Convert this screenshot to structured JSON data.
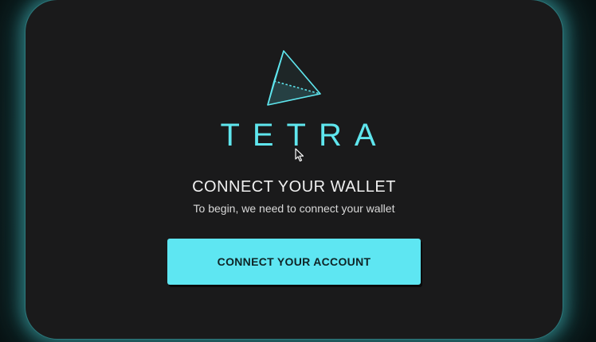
{
  "app": {
    "brand_name": "TETRA",
    "logo_icon": "tetrahedron-icon",
    "accent_color": "#5ee6f2"
  },
  "wallet_prompt": {
    "title": "CONNECT YOUR WALLET",
    "subtitle": "To begin, we need to connect your wallet",
    "connect_button_label": "CONNECT YOUR ACCOUNT"
  },
  "pointer": {
    "icon": "mouse-cursor-icon"
  }
}
